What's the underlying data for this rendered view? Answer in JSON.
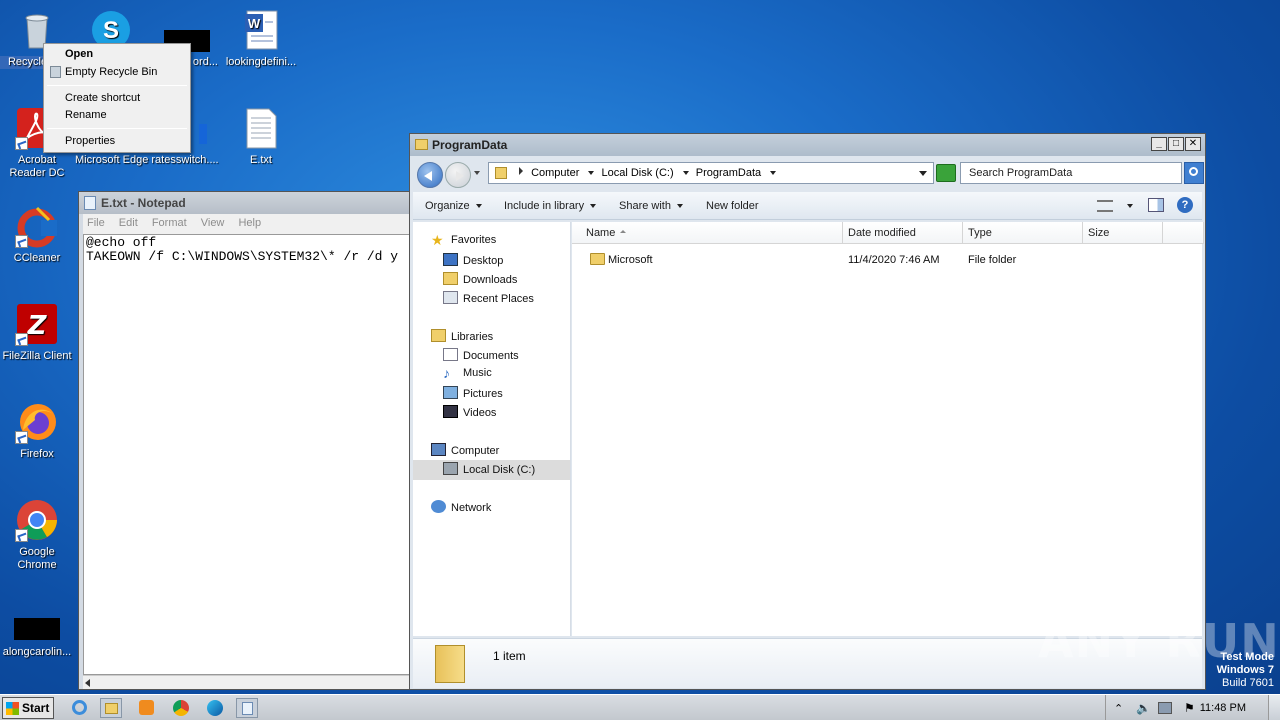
{
  "desktop": {
    "icons": [
      {
        "label": "Recycle Bin"
      },
      {
        "label": ""
      },
      {
        "label": "ord..."
      },
      {
        "label": "lookingdefini..."
      },
      {
        "label": "Acrobat Reader DC"
      },
      {
        "label": "Microsoft Edge"
      },
      {
        "label": "ratesswitch...."
      },
      {
        "label": "E.txt"
      },
      {
        "label": "CCleaner"
      },
      {
        "label": "FileZilla Client"
      },
      {
        "label": "Firefox"
      },
      {
        "label": "Google Chrome"
      },
      {
        "label": "alongcarolin..."
      }
    ]
  },
  "context_menu": {
    "items": [
      "Open",
      "Empty Recycle Bin",
      "Create shortcut",
      "Rename",
      "Properties"
    ]
  },
  "notepad": {
    "title": "E.txt - Notepad",
    "menu": [
      "File",
      "Edit",
      "Format",
      "View",
      "Help"
    ],
    "content": "@echo off\nTAKEOWN /f C:\\WINDOWS\\SYSTEM32\\* /r /d y"
  },
  "explorer": {
    "title": "ProgramData",
    "breadcrumb": [
      "Computer",
      "Local Disk (C:)",
      "ProgramData"
    ],
    "search_placeholder": "Search ProgramData",
    "toolbar": [
      "Organize",
      "Include in library",
      "Share with",
      "New folder"
    ],
    "nav": {
      "favorites": "Favorites",
      "favorites_items": [
        "Desktop",
        "Downloads",
        "Recent Places"
      ],
      "libraries": "Libraries",
      "libraries_items": [
        "Documents",
        "Music",
        "Pictures",
        "Videos"
      ],
      "computer": "Computer",
      "computer_items": [
        "Local Disk (C:)"
      ],
      "network": "Network"
    },
    "columns": [
      "Name",
      "Date modified",
      "Type",
      "Size"
    ],
    "rows": [
      {
        "name": "Microsoft",
        "date": "11/4/2020 7:46 AM",
        "type": "File folder",
        "size": ""
      }
    ],
    "details": "1 item"
  },
  "taskbar": {
    "start_label": "Start",
    "clock": "11:48 PM"
  },
  "watermark": {
    "line1": "Test Mode",
    "line2": "Windows 7",
    "line3": "Build 7601",
    "brand": "ANY RUN"
  }
}
